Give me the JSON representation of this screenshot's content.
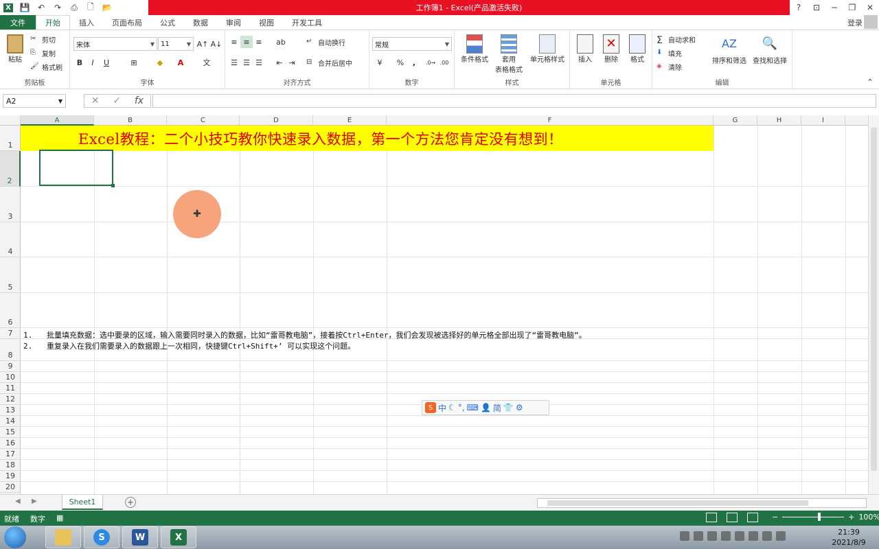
{
  "window": {
    "title": "工作簿1 - Excel(产品激活失败)",
    "help": "?",
    "minimize": "−",
    "restore": "❐",
    "close": "✕"
  },
  "tabs": {
    "file": "文件",
    "items": [
      "开始",
      "插入",
      "页面布局",
      "公式",
      "数据",
      "审阅",
      "视图",
      "开发工具"
    ],
    "login": "登录"
  },
  "ribbon": {
    "clipboard": {
      "group": "剪贴板",
      "paste": "粘贴",
      "cut": "剪切",
      "copy": "复制",
      "painter": "格式刷"
    },
    "font": {
      "group": "字体",
      "name": "宋体",
      "size": "11",
      "bold": "B",
      "italic": "I",
      "underline": "U"
    },
    "align": {
      "group": "对齐方式",
      "wrap": "自动换行",
      "merge": "合并后居中"
    },
    "number": {
      "group": "数字",
      "format": "常规",
      "percent": "%",
      "comma": ","
    },
    "styles": {
      "group": "样式",
      "cond": "条件格式",
      "table_line1": "套用",
      "table_line2": "表格格式",
      "cell": "单元格样式"
    },
    "cells": {
      "group": "单元格",
      "insert": "插入",
      "delete": "删除",
      "format": "格式"
    },
    "edit": {
      "group": "编辑",
      "autosum": "自动求和",
      "fill": "填充",
      "clear": "清除",
      "sort": "排序和筛选",
      "find": "查找和选择"
    }
  },
  "formula_bar": {
    "name_box": "A2",
    "fx": "fx",
    "content": ""
  },
  "grid": {
    "columns": [
      "A",
      "B",
      "C",
      "D",
      "E",
      "F",
      "G",
      "H",
      "I"
    ],
    "rows": [
      "1",
      "2",
      "3",
      "4",
      "5",
      "6",
      "7",
      "8",
      "9",
      "10",
      "11",
      "12",
      "13",
      "14",
      "15",
      "16",
      "17",
      "18",
      "19",
      "20"
    ],
    "banner": "Excel教程：二个小技巧教你快速录入数据，第一个方法您肯定没有想到！",
    "note1_num": "1.",
    "note1": "批量填充数据：选中要录的区域，输入需要同时录入的数据，比如“雷哥教电脑”，接着按Ctrl+Enter，我们会发现被选择好的单元格全部出现了“雷哥教电脑”。",
    "note2_num": "2.",
    "note2": "重复录入在我们需要录入的数据跟上一次相同，快捷键Ctrl+Shift+’ 可以实现这个问题。",
    "selected_cell": "A2"
  },
  "ime": {
    "items": [
      "中",
      "简"
    ]
  },
  "sheets": {
    "active": "Sheet1",
    "add": "+"
  },
  "status": {
    "ready": "就绪",
    "mode": "数字",
    "zoom": "100%"
  },
  "taskbar": {
    "time": "21:39",
    "date": "2021/8/9",
    "word": "W",
    "excel": "X",
    "sogou": "S"
  }
}
